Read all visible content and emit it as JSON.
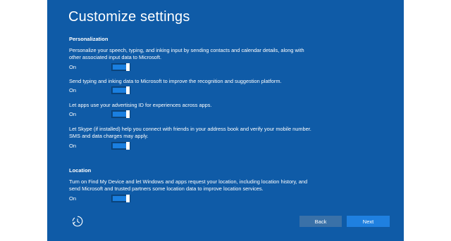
{
  "title": "Customize settings",
  "personalization": {
    "heading": "Personalization",
    "settings": [
      {
        "description": "Personalize your speech, typing, and inking input by sending contacts and calendar details, along with other associated input data to Microsoft.",
        "state_label": "On",
        "enabled": true
      },
      {
        "description": "Send typing and inking data to Microsoft to improve the recognition and suggestion platform.",
        "state_label": "On",
        "enabled": true
      },
      {
        "description": "Let apps use your advertising ID for experiences across apps.",
        "state_label": "On",
        "enabled": true
      },
      {
        "description": "Let Skype (if installed) help you connect with friends in your address book and verify your mobile number. SMS and data charges may apply.",
        "state_label": "On",
        "enabled": true
      }
    ]
  },
  "location": {
    "heading": "Location",
    "settings": [
      {
        "description": "Turn on Find My Device and let Windows and apps request your location, including location history, and send Microsoft and trusted partners some location data to improve location services.",
        "state_label": "On",
        "enabled": true
      }
    ]
  },
  "footer": {
    "ease_of_access_icon": "ease-of-access-icon",
    "back_label": "Back",
    "next_label": "Next"
  },
  "colors": {
    "background": "#0f5ba7",
    "toggle_on": "#1a7fe0",
    "next_button": "#1f80e0",
    "back_button": "#3a71a8"
  }
}
